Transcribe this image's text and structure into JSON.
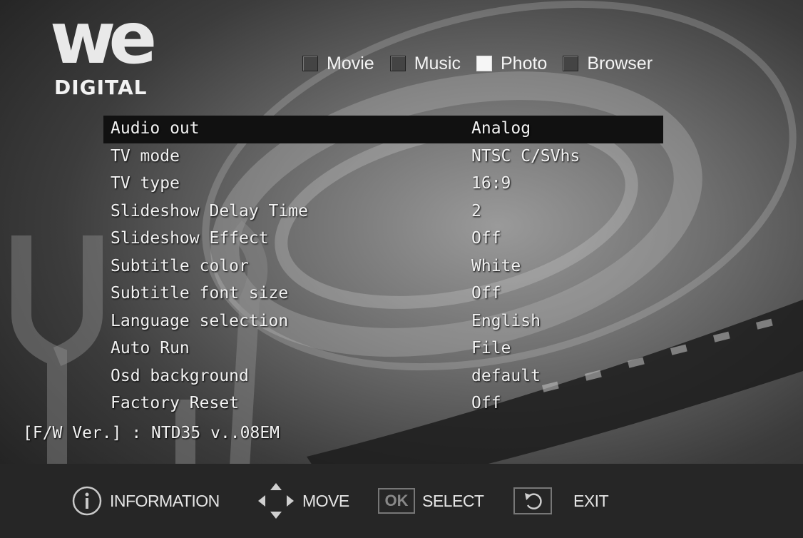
{
  "brand": {
    "logo_word": "we",
    "logo_sub": "DIGITAL"
  },
  "tabs": [
    {
      "label": "Movie",
      "active": false
    },
    {
      "label": "Music",
      "active": false
    },
    {
      "label": "Photo",
      "active": true
    },
    {
      "label": "Browser",
      "active": false
    }
  ],
  "settings": [
    {
      "label": "Audio out",
      "value": "Analog",
      "selected": true
    },
    {
      "label": "TV mode",
      "value": "NTSC C/SVhs"
    },
    {
      "label": "TV type",
      "value": "16:9"
    },
    {
      "label": "Slideshow Delay Time",
      "value": "2"
    },
    {
      "label": "Slideshow Effect",
      "value": "Off"
    },
    {
      "label": "Subtitle color",
      "value": "White"
    },
    {
      "label": "Subtitle font size",
      "value": "Off"
    },
    {
      "label": "Language selection",
      "value": "English"
    },
    {
      "label": "Auto Run",
      "value": "File"
    },
    {
      "label": "Osd background",
      "value": "default"
    },
    {
      "label": "Factory Reset",
      "value": "Off"
    }
  ],
  "firmware": "[F/W Ver.] : NTD35 v..08EM",
  "footer": {
    "info_label": "INFORMATION",
    "move_label": "MOVE",
    "ok_glyph": "OK",
    "select_label": "SELECT",
    "exit_label": "EXIT"
  },
  "icons": {
    "info": "info-icon",
    "move": "direction-arrows-icon",
    "ok": "ok-button-icon",
    "exit": "return-arrow-icon"
  },
  "colors": {
    "background": "#6f6f6f",
    "footer": "#262626",
    "highlight": "#111111",
    "text": "#f2f2f2"
  }
}
